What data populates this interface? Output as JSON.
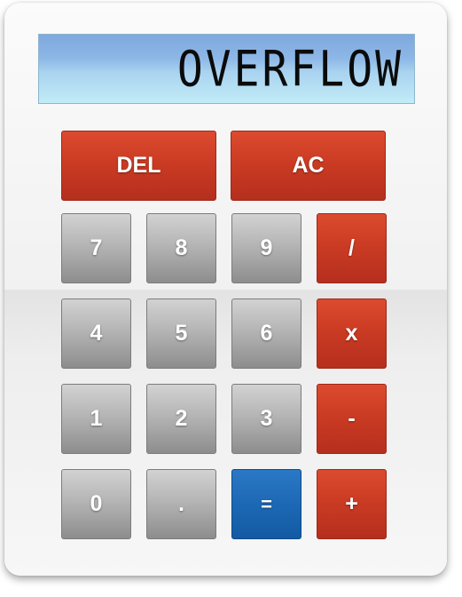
{
  "display": {
    "value": "OVERFLOW"
  },
  "buttons": {
    "del": "DEL",
    "ac": "AC",
    "seven": "7",
    "eight": "8",
    "nine": "9",
    "divide": "/",
    "four": "4",
    "five": "5",
    "six": "6",
    "multiply": "x",
    "one": "1",
    "two": "2",
    "three": "3",
    "minus": "-",
    "zero": "0",
    "decimal": ".",
    "equals": "=",
    "plus": "+"
  },
  "colors": {
    "operator": "#c93a23",
    "equals": "#1c67b3",
    "number": "#a8a8a8",
    "display": "#a9d3ef"
  }
}
